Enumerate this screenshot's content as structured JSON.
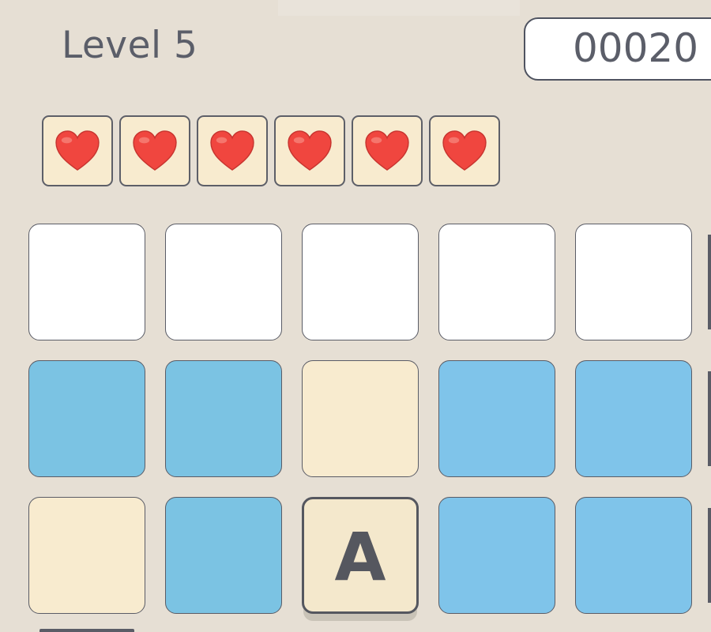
{
  "header": {
    "level_label": "Level 5",
    "score": "00020"
  },
  "lives": {
    "count": 6,
    "icon": "heart-icon",
    "color": "#f0463f"
  },
  "board": {
    "rows": [
      [
        "white",
        "white",
        "white",
        "white",
        "white"
      ],
      [
        "blue-a",
        "blue-a",
        "cream",
        "blue-b",
        "blue-b"
      ],
      [
        "cream",
        "blue-a",
        "selected",
        "blue-b",
        "blue-b"
      ]
    ],
    "selected_letter": "A",
    "colors": {
      "white": "#ffffff",
      "blue-a": "#7bc3e3",
      "blue-b": "#7fc4ea",
      "cream": "#f8ebcf",
      "background": "#e6dfd4"
    }
  }
}
